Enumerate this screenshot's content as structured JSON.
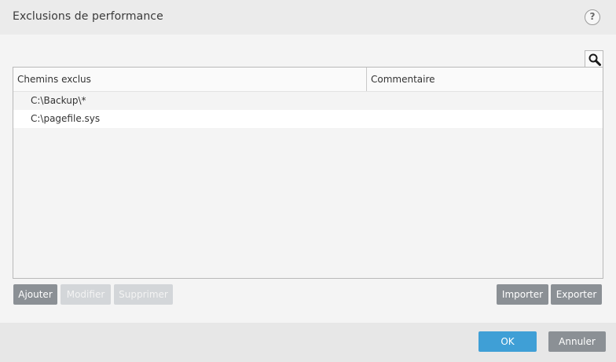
{
  "window": {
    "title": "Exclusions de performance",
    "help_label": "?"
  },
  "search": {
    "icon": "search-icon"
  },
  "table": {
    "columns": [
      "Chemins exclus",
      "Commentaire"
    ],
    "rows": [
      {
        "path": "C:\\Backup\\*",
        "comment": ""
      },
      {
        "path": "C:\\pagefile.sys",
        "comment": ""
      }
    ]
  },
  "actions": {
    "add": "Ajouter",
    "edit": "Modifier",
    "delete": "Supprimer",
    "import": "Importer",
    "export": "Exporter"
  },
  "footer": {
    "ok": "OK",
    "cancel": "Annuler"
  },
  "colors": {
    "accent": "#3f9fd6",
    "button_gray": "#8b9095",
    "button_disabled": "#d3d6d9"
  }
}
